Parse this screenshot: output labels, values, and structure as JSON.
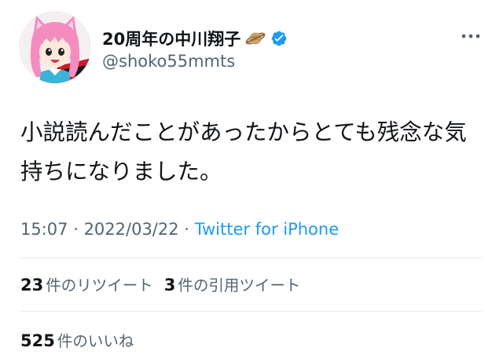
{
  "tweet": {
    "author": {
      "display_name": "20周年の中川翔子",
      "handle": "@shoko55mmts",
      "badge_icon": "planet-emoji-icon",
      "verified_icon": "verified-badge-icon",
      "verified_color": "#1d9bf0"
    },
    "more_icon": "more-options-icon",
    "text": "小説読んだことがあったからとても残念な気持ちになりました。",
    "meta": {
      "time": "15:07",
      "separator1": " · ",
      "date": "2022/03/22",
      "separator2": " · ",
      "source": "Twitter for iPhone"
    },
    "stats": {
      "retweets": {
        "count": "23",
        "label": "件のリツイート"
      },
      "quotes": {
        "count": "3",
        "label": "件の引用ツイート"
      },
      "likes": {
        "count": "525",
        "label": "件のいいね"
      }
    }
  },
  "colors": {
    "text_primary": "#0f1419",
    "text_secondary": "#536471",
    "link": "#1d9bf0",
    "divider": "#e6ecf0"
  }
}
